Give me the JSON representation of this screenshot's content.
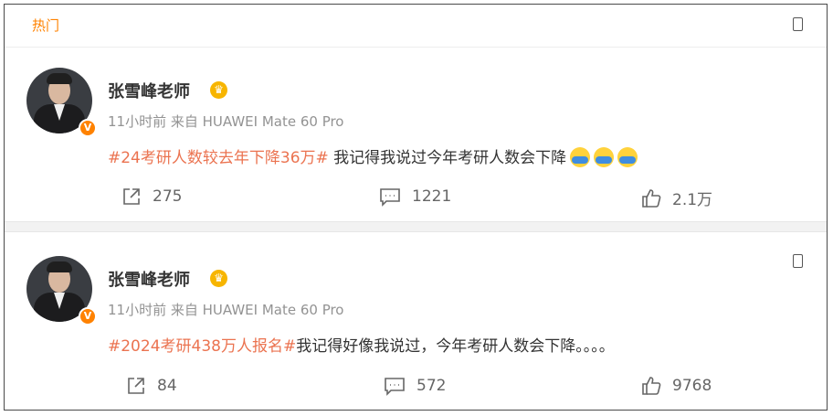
{
  "section": {
    "title": "热门"
  },
  "posts": [
    {
      "username": "张雪峰老师",
      "meta": "11小时前 来自 HUAWEI Mate 60 Pro",
      "topic": "#24考研人数较去年下降36万#",
      "text": " 我记得我说过今年考研人数会下降",
      "emoji_icons": [
        "grin-sweat-emoji-icon",
        "grin-sweat-emoji-icon",
        "grin-sweat-emoji-icon"
      ],
      "reposts": "275",
      "comments": "1221",
      "likes": "2.1万"
    },
    {
      "username": "张雪峰老师",
      "meta": "11小时前 来自 HUAWEI Mate 60 Pro",
      "topic": "#2024考研438万人报名#",
      "text": "我记得好像我说过，今年考研人数会下降。。。。",
      "reposts": "84",
      "comments": "572",
      "likes": "9768"
    }
  ],
  "icons": {
    "menu": "more-menu-icon",
    "repost": "repost-icon",
    "comment": "comment-icon",
    "like": "thumbs-up-icon",
    "verified": "verified-badge-icon",
    "vip": "vip-crown-icon"
  },
  "colors": {
    "accent": "#ff8200",
    "topic": "#eb7350",
    "meta": "#939393"
  }
}
